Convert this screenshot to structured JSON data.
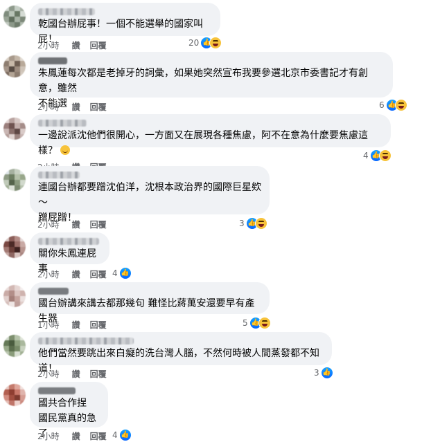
{
  "comments": [
    {
      "text": "乾國台辦屁事！一個不能選舉的國家叫屁！",
      "time": "2小時",
      "like": "讚",
      "reply": "回覆",
      "count": "20",
      "reactions": [
        "like-icon",
        "haha-icon"
      ]
    },
    {
      "text": "朱鳳蓮每次都是老掉牙的詞彙，如果她突然宣布我要參選北京市委書記才有創意，雖然\n不能選",
      "time": "2小時",
      "like": "讚",
      "reply": "回覆",
      "count": "6",
      "reactions": [
        "like-icon",
        "haha-icon"
      ]
    },
    {
      "text": "一邊說派沈他們很開心，一方面又在展現各種焦慮，阿不在意為什麼要焦慮這樣？",
      "time": "2小時",
      "like": "讚",
      "reply": "回覆",
      "count": "4",
      "reactions": [
        "like-icon",
        "haha-icon"
      ]
    },
    {
      "text": "連國台辦都要蹭沈伯洋，沈根本政治界的國際巨星欸～\n蹭屁蹭！",
      "time": "2小時",
      "like": "讚",
      "reply": "回覆",
      "count": "3",
      "reactions": [
        "like-icon",
        "haha-icon"
      ]
    },
    {
      "text": "關你朱鳳連屁事",
      "time": "2小時",
      "like": "讚",
      "reply": "回覆",
      "count": "4",
      "reactions": [
        "like-icon"
      ]
    },
    {
      "text": "國台辦講來講去都那幾句 難怪比蔣萬安還要早有產生器",
      "time": "1小時",
      "like": "讚",
      "reply": "回覆",
      "count": "5",
      "reactions": [
        "like-icon",
        "haha-icon"
      ]
    },
    {
      "text": "他們當然要跳出來白癡的洗台灣人腦，不然何時被人間蒸發都不知道！",
      "time": "2小時",
      "like": "讚",
      "reply": "回覆",
      "count": "3",
      "reactions": [
        "like-icon"
      ]
    },
    {
      "text": "國共合作捏\n國民黨真的急了",
      "time": "2小時",
      "like": "讚",
      "reply": "回覆",
      "count": "4",
      "reactions": [
        "like-icon"
      ]
    }
  ],
  "colors": {
    "bubble": "#f0f2f5",
    "meta": "#65676b",
    "like": "#0866ff",
    "haha": "#f7c33b"
  }
}
